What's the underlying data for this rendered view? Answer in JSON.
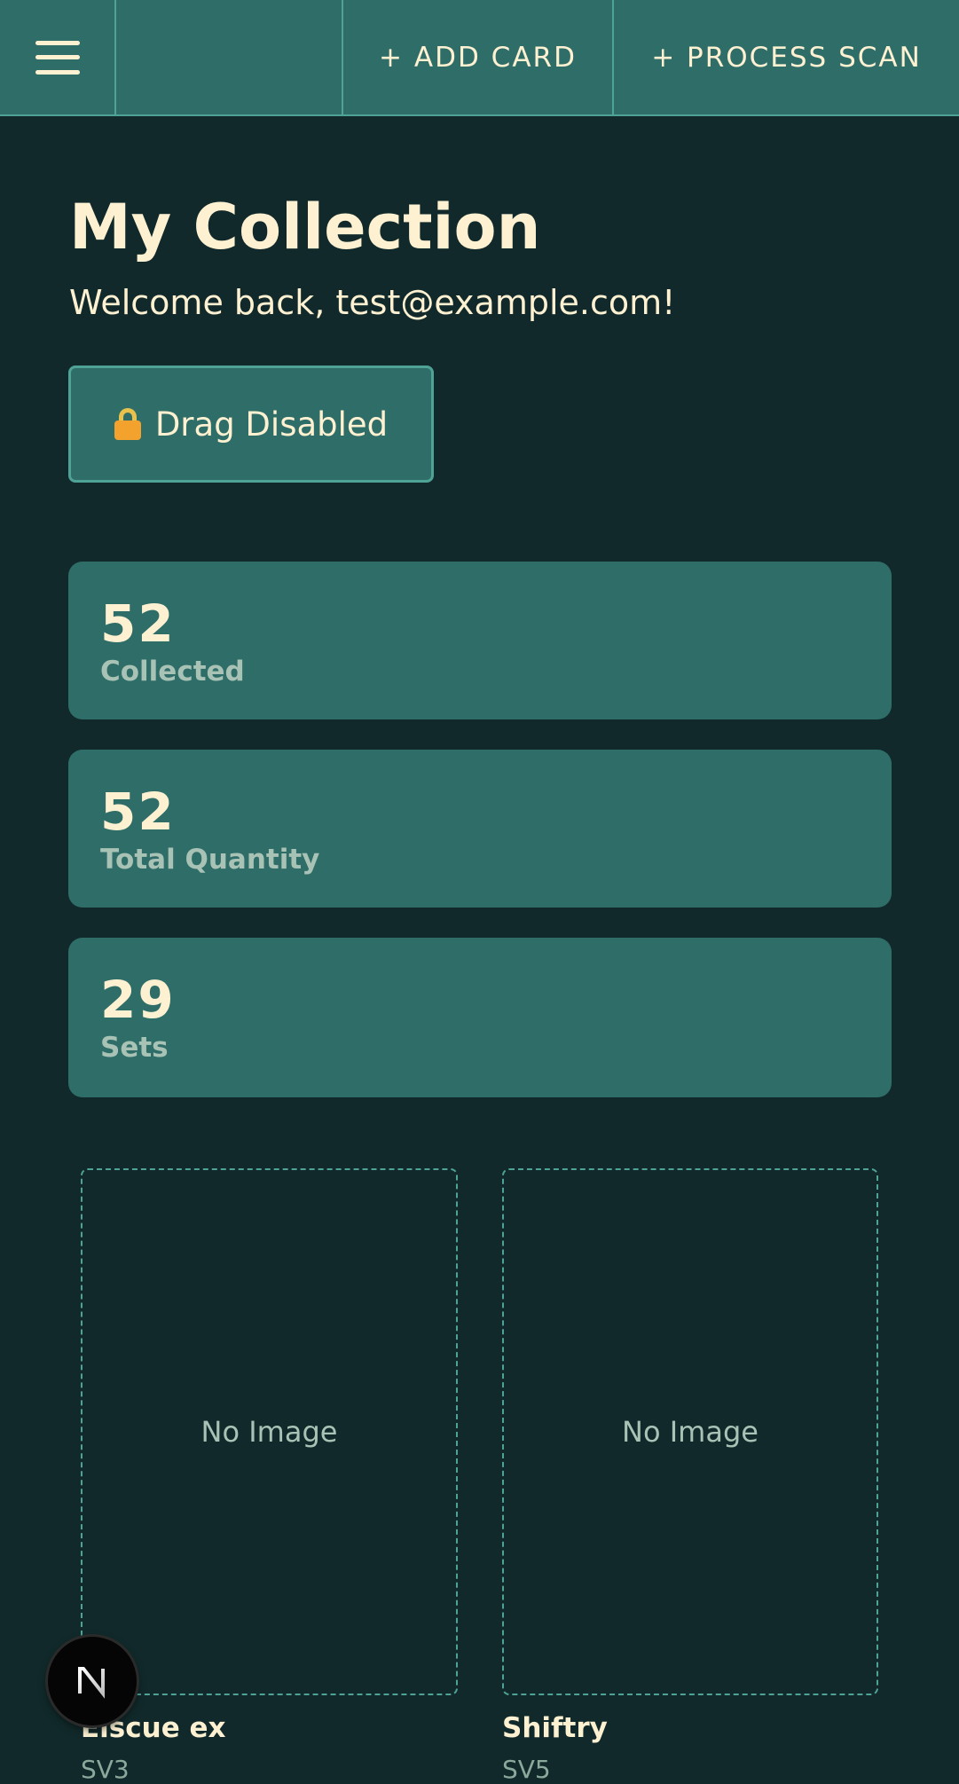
{
  "header": {
    "add_card_label": "+ ADD CARD",
    "process_scan_label": "+ PROCESS SCAN"
  },
  "page": {
    "title": "My Collection",
    "welcome": "Welcome back, test@example.com!"
  },
  "drag_toggle": {
    "label": "Drag Disabled",
    "icon": "lock-icon"
  },
  "stats": [
    {
      "value": "52",
      "label": "Collected"
    },
    {
      "value": "52",
      "label": "Total Quantity"
    },
    {
      "value": "29",
      "label": "Sets"
    }
  ],
  "cards": [
    {
      "image_text": "No Image",
      "name": "Eiscue ex",
      "set": "SV3"
    },
    {
      "image_text": "No Image",
      "name": "Shiftry",
      "set": "SV5"
    }
  ],
  "colors": {
    "background": "#11292a",
    "panel": "#2f6d68",
    "border": "#4fa396",
    "text": "#fdf1d2",
    "muted": "#a8c3b5"
  }
}
